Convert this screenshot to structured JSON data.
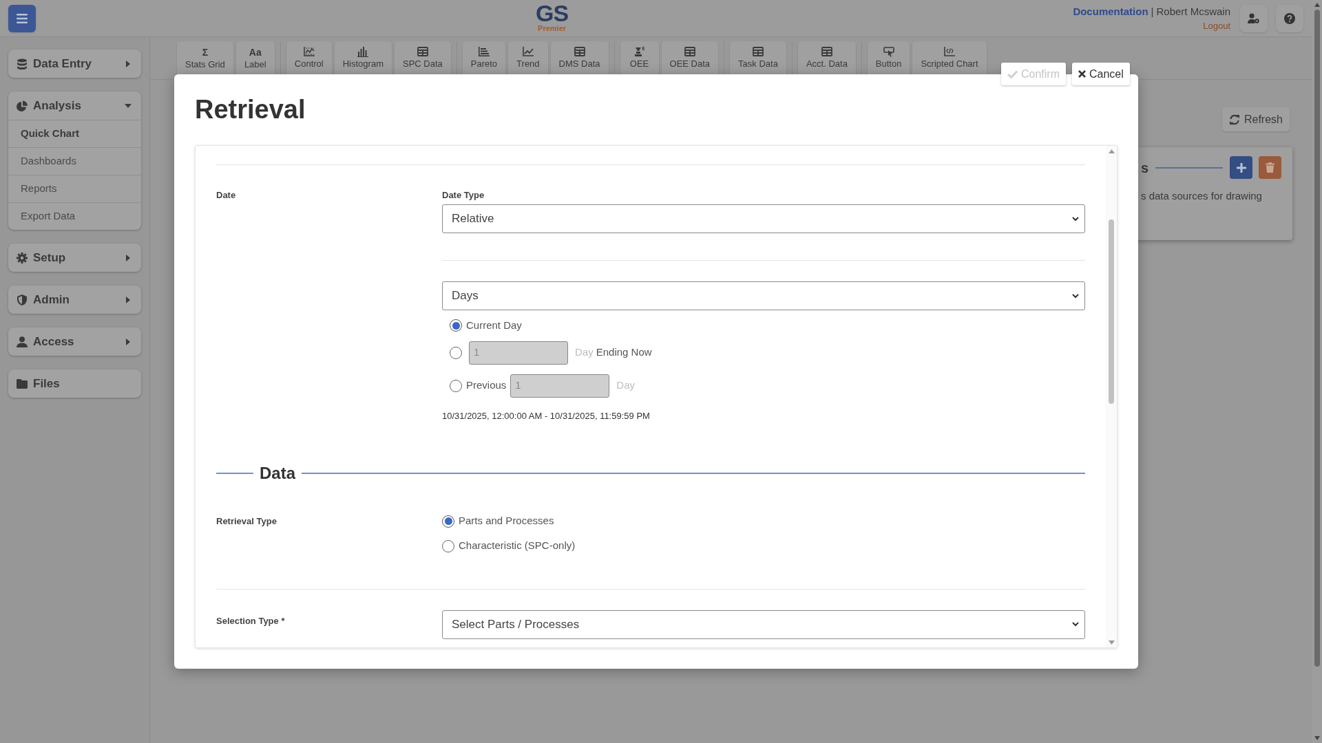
{
  "header": {
    "logo": {
      "title": "GS",
      "subtitle": "Premier"
    },
    "documentation": "Documentation",
    "separator": "|",
    "user": "Robert Mcswain",
    "logout": "Logout"
  },
  "sidebar": [
    {
      "label": "Data Entry",
      "expanded": false
    },
    {
      "label": "Analysis",
      "expanded": true,
      "items": [
        {
          "label": "Quick Chart",
          "selected": true
        },
        {
          "label": "Dashboards",
          "selected": false
        },
        {
          "label": "Reports",
          "selected": false
        },
        {
          "label": "Export Data",
          "selected": false
        }
      ]
    },
    {
      "label": "Setup",
      "expanded": false
    },
    {
      "label": "Admin",
      "expanded": false
    },
    {
      "label": "Access",
      "expanded": false
    },
    {
      "label": "Files"
    }
  ],
  "toolbar": [
    [
      {
        "label": "Stats Grid",
        "glyph": "Σ"
      },
      {
        "label": "Label",
        "glyph": "Aa"
      }
    ],
    [
      {
        "label": "Control"
      },
      {
        "label": "Histogram"
      },
      {
        "label": "SPC Data"
      }
    ],
    [
      {
        "label": "Pareto"
      },
      {
        "label": "Trend"
      },
      {
        "label": "DMS Data"
      }
    ],
    [
      {
        "label": "OEE"
      },
      {
        "label": "OEE Data"
      }
    ],
    [
      {
        "label": "Task Data"
      }
    ],
    [
      {
        "label": "Acct. Data"
      }
    ],
    [
      {
        "label": "Button"
      },
      {
        "label": "Scripted Chart"
      }
    ]
  ],
  "background": {
    "refresh": "Refresh",
    "card_heading": "s",
    "card_text": "s data sources for drawing"
  },
  "modal": {
    "title": "Retrieval",
    "actions": [
      {
        "label": "Confirm",
        "disabled": true
      },
      {
        "label": "Cancel",
        "disabled": false
      }
    ],
    "date": {
      "label": "Date",
      "date_type_label": "Date Type",
      "date_type": "Relative",
      "unit": "Days",
      "options": [
        {
          "kind": "plain",
          "label": "Current Day",
          "selected": true
        },
        {
          "kind": "count",
          "value": "1",
          "unit": "Day",
          "suffix": "Ending Now",
          "selected": false,
          "disabled": true
        },
        {
          "kind": "previous",
          "label": "Previous",
          "value": "1",
          "unit": "Day",
          "selected": false,
          "disabled": true
        }
      ],
      "range": "10/31/2025, 12:00:00 AM - 10/31/2025, 11:59:59 PM"
    },
    "data": {
      "heading": "Data",
      "retrieval_type_label": "Retrieval Type",
      "retrieval_types": [
        {
          "label": "Parts and Processes",
          "selected": true
        },
        {
          "label": "Characteristic (SPC-only)",
          "selected": false
        }
      ],
      "selection_type_label": "Selection Type *",
      "selection_type": "Select Parts / Processes"
    }
  }
}
